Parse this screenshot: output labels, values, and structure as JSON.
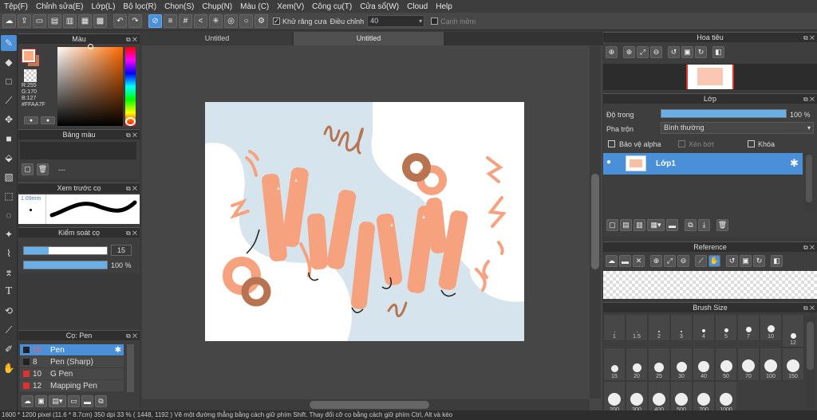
{
  "menu": [
    "Tệp(F)",
    "Chỉnh sửa(E)",
    "Lớp(L)",
    "Bộ lọc(R)",
    "Chọn(S)",
    "Chụp(N)",
    "Màu (C)",
    "Xem(V)",
    "Công cụ(T)",
    "Cửa sổ(W)",
    "Cloud",
    "Help"
  ],
  "toolbar": {
    "antialias_label": "Khử răng cưa",
    "adjust_label": "Điều chỉnh",
    "adjust_value": "40",
    "smooth_label": "Cạnh mềm"
  },
  "color_panel": {
    "title": "Màu",
    "r": "R:255",
    "g": "G:170",
    "b": "B:127",
    "hex": "#FFAA7F"
  },
  "palette_panel": {
    "title": "Bảng màu",
    "dash": "---"
  },
  "brush_preview": {
    "title": "Xem trước cọ",
    "size": "1.09mm"
  },
  "brush_control": {
    "title": "Kiểm soát cọ",
    "size_value": "15",
    "opacity_value": "100 %"
  },
  "brush_list": {
    "title": "Cọ: Pen",
    "items": [
      {
        "size": "15",
        "name": "Pen"
      },
      {
        "size": "8",
        "name": "Pen (Sharp)"
      },
      {
        "size": "10",
        "name": "G Pen"
      },
      {
        "size": "12",
        "name": "Mapping Pen"
      }
    ]
  },
  "tabs": [
    "Untitled",
    "Untitled"
  ],
  "navigator": {
    "title": "Hoa tiêu"
  },
  "layer_panel": {
    "title": "Lớp",
    "opacity_label": "Độ trong",
    "opacity_value": "100 %",
    "opacity": 1.0,
    "blend_label": "Pha trộn",
    "blend_value": "Bình thường",
    "protect_alpha": "Bảo vệ alpha",
    "clipping": "Xén bớt",
    "lock": "Khóa",
    "layer_name": "Lớp1"
  },
  "reference_panel": {
    "title": "Reference"
  },
  "brush_size_panel": {
    "title": "Brush Size",
    "sizes": [
      "1",
      "1.5",
      "2",
      "3",
      "4",
      "5",
      "7",
      "10",
      "12",
      "15",
      "20",
      "25",
      "30",
      "40",
      "50",
      "70",
      "100",
      "150",
      "200",
      "300",
      "400",
      "500",
      "700",
      "1000"
    ]
  },
  "status": "1600 * 1200 pixel   (11.6 * 8.7cm)   350 dpi   33 %   ( 1448, 1192 )   Vẽ một đường thẳng bằng cách giữ phím Shift. Thay đổi cỡ cọ bằng cách giữ phím Ctrl, Alt và kéo",
  "colors": {
    "accent": "#4a90d9",
    "fg_color": "#ffaa7f",
    "peach": "#f7a27e",
    "brown": "#b87350",
    "sky": "#d6e4ed"
  }
}
